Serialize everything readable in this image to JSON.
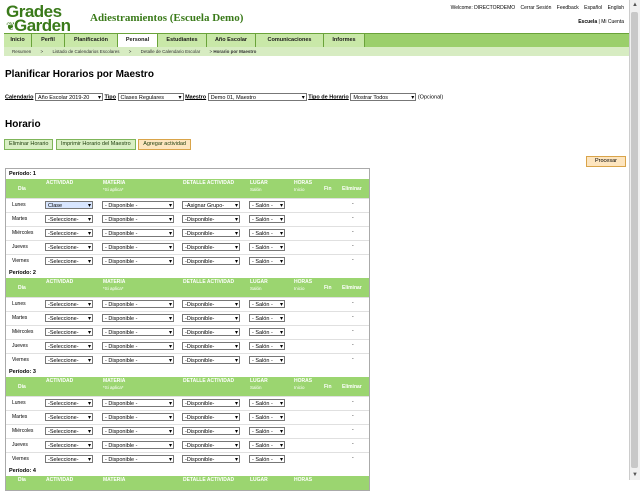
{
  "logo": {
    "line1": "Grades",
    "line2": "Garden"
  },
  "app_title": "Adiestramientos (Escuela Demo)",
  "toplinks": [
    "Welcome: DIRECTORDEMO",
    "Cerrar Sesión",
    "Feedback",
    "Español",
    "English"
  ],
  "school": {
    "active": "Escuela",
    "sep": "|",
    "account": "Mi Cuenta"
  },
  "nav": [
    "Inicio",
    "Perfil",
    "Planificación",
    "Personal",
    "Estudiantes",
    "Año Escolar",
    "Comunicaciones",
    "Informes"
  ],
  "breadcrumbs": [
    "Resumen",
    ">",
    "Listado de Calendarios Escolares",
    ">",
    "Detalle de Calendario Escolar",
    ">",
    "Horario por Maestro"
  ],
  "page_title": "Planificar Horarios por Maestro",
  "filters": {
    "calendario_label": "Calendario",
    "calendario_value": "Año Escolar 2019-20",
    "tipo_label": "Tipo",
    "tipo_value": "Clases Regulares",
    "maestro_label": "Maestro",
    "maestro_value": "Demo 01, Maestro",
    "tipo_horario_label": "Tipo de Horario",
    "tipo_horario_value": "Mostrar Todos",
    "opcional": "(Opcional)"
  },
  "section_title": "Horario",
  "buttons": {
    "eliminar": "Eliminar Horario",
    "imprimir": "Imprimir Horario del Maestro",
    "agregar": "Agregar actividad",
    "procesar": "Procesar"
  },
  "headers": {
    "dia": "Día",
    "actividad": "ACTIVIDAD",
    "materia": "MATERIA",
    "materia_sub": "*Si aplica*",
    "detalle": "DETALLE ACTIVIDAD",
    "lugar": "LUGAR",
    "lugar_sub": "Salón",
    "horas": "HORAS",
    "horas_sub": "Inicio",
    "fin": "Fin",
    "eliminar": "Eliminar"
  },
  "days": [
    "Lunes",
    "Martes",
    "Miércoles",
    "Jueves",
    "Viernes"
  ],
  "periods": [
    "Período: 1",
    "Período: 2",
    "Período: 3",
    "Período: 4"
  ],
  "options": {
    "actividad_first": "Clase",
    "actividad": "-Seleccione-",
    "materia": "- Disponible -",
    "detalle_first": "-Asignar Grupo-",
    "detalle": "-Disponible-",
    "lugar": "- Salón -",
    "dash": "-"
  }
}
